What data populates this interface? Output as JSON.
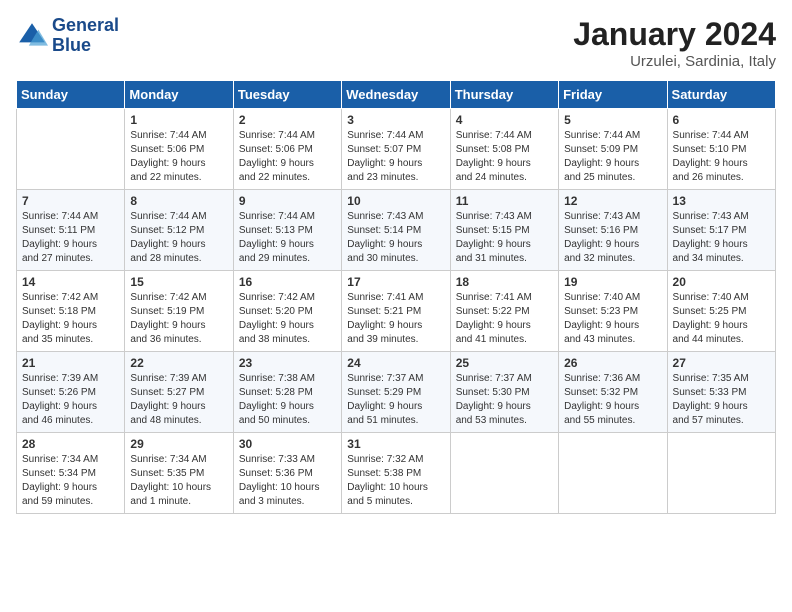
{
  "logo": {
    "line1": "General",
    "line2": "Blue"
  },
  "title": "January 2024",
  "location": "Urzulei, Sardinia, Italy",
  "days_of_week": [
    "Sunday",
    "Monday",
    "Tuesday",
    "Wednesday",
    "Thursday",
    "Friday",
    "Saturday"
  ],
  "weeks": [
    [
      {
        "day": "",
        "info": ""
      },
      {
        "day": "1",
        "info": "Sunrise: 7:44 AM\nSunset: 5:06 PM\nDaylight: 9 hours\nand 22 minutes."
      },
      {
        "day": "2",
        "info": "Sunrise: 7:44 AM\nSunset: 5:06 PM\nDaylight: 9 hours\nand 22 minutes."
      },
      {
        "day": "3",
        "info": "Sunrise: 7:44 AM\nSunset: 5:07 PM\nDaylight: 9 hours\nand 23 minutes."
      },
      {
        "day": "4",
        "info": "Sunrise: 7:44 AM\nSunset: 5:08 PM\nDaylight: 9 hours\nand 24 minutes."
      },
      {
        "day": "5",
        "info": "Sunrise: 7:44 AM\nSunset: 5:09 PM\nDaylight: 9 hours\nand 25 minutes."
      },
      {
        "day": "6",
        "info": "Sunrise: 7:44 AM\nSunset: 5:10 PM\nDaylight: 9 hours\nand 26 minutes."
      }
    ],
    [
      {
        "day": "7",
        "info": "Sunrise: 7:44 AM\nSunset: 5:11 PM\nDaylight: 9 hours\nand 27 minutes."
      },
      {
        "day": "8",
        "info": "Sunrise: 7:44 AM\nSunset: 5:12 PM\nDaylight: 9 hours\nand 28 minutes."
      },
      {
        "day": "9",
        "info": "Sunrise: 7:44 AM\nSunset: 5:13 PM\nDaylight: 9 hours\nand 29 minutes."
      },
      {
        "day": "10",
        "info": "Sunrise: 7:43 AM\nSunset: 5:14 PM\nDaylight: 9 hours\nand 30 minutes."
      },
      {
        "day": "11",
        "info": "Sunrise: 7:43 AM\nSunset: 5:15 PM\nDaylight: 9 hours\nand 31 minutes."
      },
      {
        "day": "12",
        "info": "Sunrise: 7:43 AM\nSunset: 5:16 PM\nDaylight: 9 hours\nand 32 minutes."
      },
      {
        "day": "13",
        "info": "Sunrise: 7:43 AM\nSunset: 5:17 PM\nDaylight: 9 hours\nand 34 minutes."
      }
    ],
    [
      {
        "day": "14",
        "info": "Sunrise: 7:42 AM\nSunset: 5:18 PM\nDaylight: 9 hours\nand 35 minutes."
      },
      {
        "day": "15",
        "info": "Sunrise: 7:42 AM\nSunset: 5:19 PM\nDaylight: 9 hours\nand 36 minutes."
      },
      {
        "day": "16",
        "info": "Sunrise: 7:42 AM\nSunset: 5:20 PM\nDaylight: 9 hours\nand 38 minutes."
      },
      {
        "day": "17",
        "info": "Sunrise: 7:41 AM\nSunset: 5:21 PM\nDaylight: 9 hours\nand 39 minutes."
      },
      {
        "day": "18",
        "info": "Sunrise: 7:41 AM\nSunset: 5:22 PM\nDaylight: 9 hours\nand 41 minutes."
      },
      {
        "day": "19",
        "info": "Sunrise: 7:40 AM\nSunset: 5:23 PM\nDaylight: 9 hours\nand 43 minutes."
      },
      {
        "day": "20",
        "info": "Sunrise: 7:40 AM\nSunset: 5:25 PM\nDaylight: 9 hours\nand 44 minutes."
      }
    ],
    [
      {
        "day": "21",
        "info": "Sunrise: 7:39 AM\nSunset: 5:26 PM\nDaylight: 9 hours\nand 46 minutes."
      },
      {
        "day": "22",
        "info": "Sunrise: 7:39 AM\nSunset: 5:27 PM\nDaylight: 9 hours\nand 48 minutes."
      },
      {
        "day": "23",
        "info": "Sunrise: 7:38 AM\nSunset: 5:28 PM\nDaylight: 9 hours\nand 50 minutes."
      },
      {
        "day": "24",
        "info": "Sunrise: 7:37 AM\nSunset: 5:29 PM\nDaylight: 9 hours\nand 51 minutes."
      },
      {
        "day": "25",
        "info": "Sunrise: 7:37 AM\nSunset: 5:30 PM\nDaylight: 9 hours\nand 53 minutes."
      },
      {
        "day": "26",
        "info": "Sunrise: 7:36 AM\nSunset: 5:32 PM\nDaylight: 9 hours\nand 55 minutes."
      },
      {
        "day": "27",
        "info": "Sunrise: 7:35 AM\nSunset: 5:33 PM\nDaylight: 9 hours\nand 57 minutes."
      }
    ],
    [
      {
        "day": "28",
        "info": "Sunrise: 7:34 AM\nSunset: 5:34 PM\nDaylight: 9 hours\nand 59 minutes."
      },
      {
        "day": "29",
        "info": "Sunrise: 7:34 AM\nSunset: 5:35 PM\nDaylight: 10 hours\nand 1 minute."
      },
      {
        "day": "30",
        "info": "Sunrise: 7:33 AM\nSunset: 5:36 PM\nDaylight: 10 hours\nand 3 minutes."
      },
      {
        "day": "31",
        "info": "Sunrise: 7:32 AM\nSunset: 5:38 PM\nDaylight: 10 hours\nand 5 minutes."
      },
      {
        "day": "",
        "info": ""
      },
      {
        "day": "",
        "info": ""
      },
      {
        "day": "",
        "info": ""
      }
    ]
  ]
}
